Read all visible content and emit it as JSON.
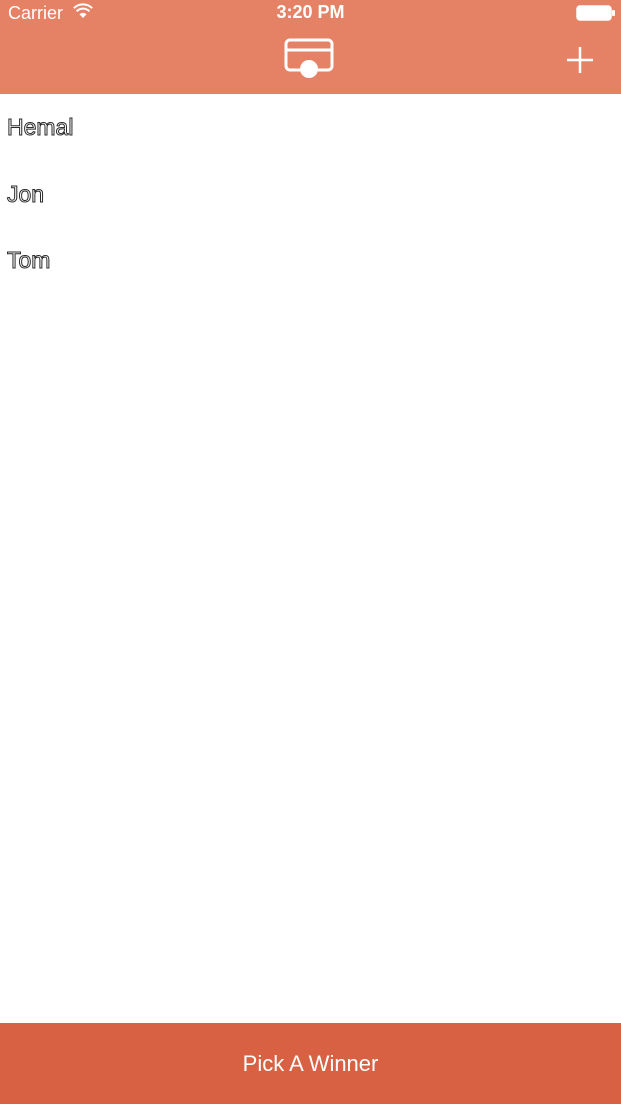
{
  "status_bar": {
    "carrier": "Carrier",
    "time": "3:20 PM",
    "wifi_icon": "wifi-icon",
    "battery_icon": "battery-icon"
  },
  "nav_bar": {
    "logo_icon": "card-coin-icon",
    "add_icon": "plus-icon"
  },
  "contestants": [
    {
      "name": "Hemal"
    },
    {
      "name": "Jon"
    },
    {
      "name": "Tom"
    }
  ],
  "pick_button": {
    "label": "Pick A Winner"
  },
  "colors": {
    "header": "#e58265",
    "button": "#d96143",
    "background": "#ffffff"
  }
}
